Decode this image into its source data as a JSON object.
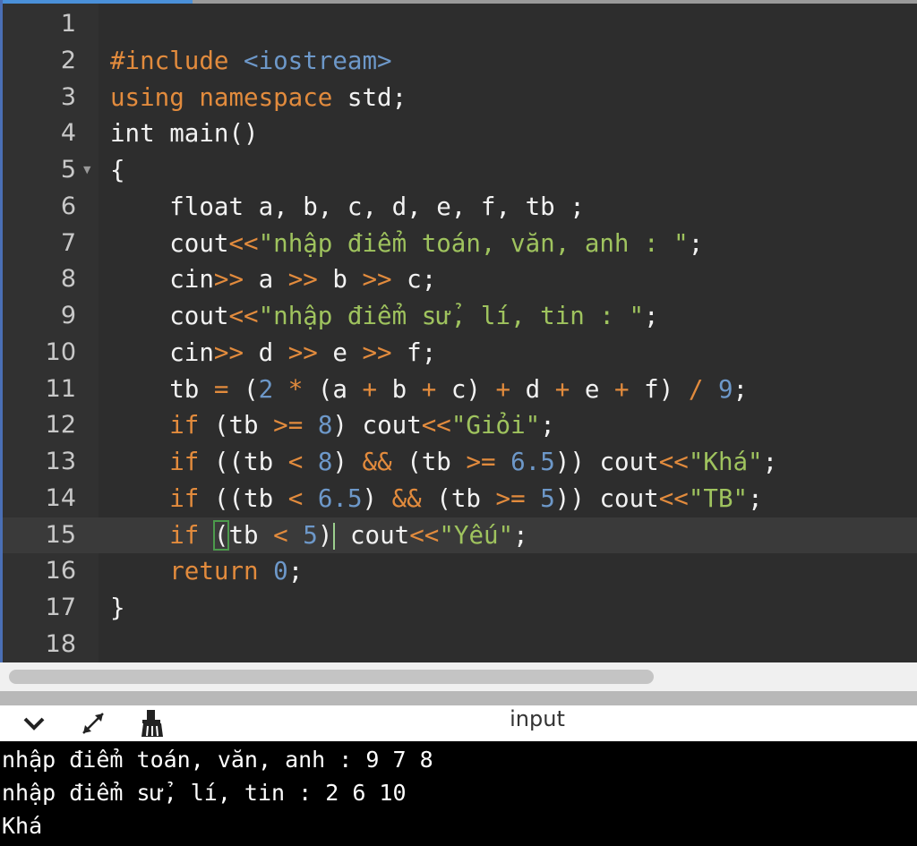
{
  "editor": {
    "active_line": 15,
    "lines": [
      {
        "num": "1",
        "tokens": []
      },
      {
        "num": "2",
        "tokens": [
          {
            "t": "#include ",
            "c": "kw"
          },
          {
            "t": "<iostream>",
            "c": "num"
          }
        ]
      },
      {
        "num": "3",
        "tokens": [
          {
            "t": "using namespace ",
            "c": "kw"
          },
          {
            "t": "std;",
            "c": ""
          }
        ]
      },
      {
        "num": "4",
        "tokens": [
          {
            "t": "int main()",
            "c": ""
          }
        ]
      },
      {
        "num": "5",
        "fold": true,
        "tokens": [
          {
            "t": "{",
            "c": ""
          }
        ]
      },
      {
        "num": "6",
        "tokens": [
          {
            "t": "    float a, b, c, d, e, f, tb ;",
            "c": ""
          }
        ]
      },
      {
        "num": "7",
        "tokens": [
          {
            "t": "    cout",
            "c": ""
          },
          {
            "t": "<<",
            "c": "op"
          },
          {
            "t": "\"nhập điểm toán, văn, anh : \"",
            "c": "str"
          },
          {
            "t": ";",
            "c": ""
          }
        ]
      },
      {
        "num": "8",
        "tokens": [
          {
            "t": "    cin",
            "c": ""
          },
          {
            "t": ">>",
            "c": "op"
          },
          {
            "t": " a ",
            "c": ""
          },
          {
            "t": ">>",
            "c": "op"
          },
          {
            "t": " b ",
            "c": ""
          },
          {
            "t": ">>",
            "c": "op"
          },
          {
            "t": " c;",
            "c": ""
          }
        ]
      },
      {
        "num": "9",
        "tokens": [
          {
            "t": "    cout",
            "c": ""
          },
          {
            "t": "<<",
            "c": "op"
          },
          {
            "t": "\"nhập điểm sử, lí, tin : \"",
            "c": "str"
          },
          {
            "t": ";",
            "c": ""
          }
        ]
      },
      {
        "num": "10",
        "tokens": [
          {
            "t": "    cin",
            "c": ""
          },
          {
            "t": ">>",
            "c": "op"
          },
          {
            "t": " d ",
            "c": ""
          },
          {
            "t": ">>",
            "c": "op"
          },
          {
            "t": " e ",
            "c": ""
          },
          {
            "t": ">>",
            "c": "op"
          },
          {
            "t": " f;",
            "c": ""
          }
        ]
      },
      {
        "num": "11",
        "tokens": [
          {
            "t": "    tb ",
            "c": ""
          },
          {
            "t": "=",
            "c": "op"
          },
          {
            "t": " (",
            "c": ""
          },
          {
            "t": "2",
            "c": "num"
          },
          {
            "t": " ",
            "c": ""
          },
          {
            "t": "*",
            "c": "op"
          },
          {
            "t": " (a ",
            "c": ""
          },
          {
            "t": "+",
            "c": "op"
          },
          {
            "t": " b ",
            "c": ""
          },
          {
            "t": "+",
            "c": "op"
          },
          {
            "t": " c) ",
            "c": ""
          },
          {
            "t": "+",
            "c": "op"
          },
          {
            "t": " d ",
            "c": ""
          },
          {
            "t": "+",
            "c": "op"
          },
          {
            "t": " e ",
            "c": ""
          },
          {
            "t": "+",
            "c": "op"
          },
          {
            "t": " f) ",
            "c": ""
          },
          {
            "t": "/",
            "c": "op"
          },
          {
            "t": " ",
            "c": ""
          },
          {
            "t": "9",
            "c": "num"
          },
          {
            "t": ";",
            "c": ""
          }
        ]
      },
      {
        "num": "12",
        "tokens": [
          {
            "t": "    ",
            "c": ""
          },
          {
            "t": "if",
            "c": "kw"
          },
          {
            "t": " (tb ",
            "c": ""
          },
          {
            "t": ">=",
            "c": "op"
          },
          {
            "t": " ",
            "c": ""
          },
          {
            "t": "8",
            "c": "num"
          },
          {
            "t": ") cout",
            "c": ""
          },
          {
            "t": "<<",
            "c": "op"
          },
          {
            "t": "\"Giỏi\"",
            "c": "str"
          },
          {
            "t": ";",
            "c": ""
          }
        ]
      },
      {
        "num": "13",
        "tokens": [
          {
            "t": "    ",
            "c": ""
          },
          {
            "t": "if",
            "c": "kw"
          },
          {
            "t": " ((tb ",
            "c": ""
          },
          {
            "t": "<",
            "c": "op"
          },
          {
            "t": " ",
            "c": ""
          },
          {
            "t": "8",
            "c": "num"
          },
          {
            "t": ") ",
            "c": ""
          },
          {
            "t": "&&",
            "c": "op"
          },
          {
            "t": " (tb ",
            "c": ""
          },
          {
            "t": ">=",
            "c": "op"
          },
          {
            "t": " ",
            "c": ""
          },
          {
            "t": "6.5",
            "c": "num"
          },
          {
            "t": ")) cout",
            "c": ""
          },
          {
            "t": "<<",
            "c": "op"
          },
          {
            "t": "\"Khá\"",
            "c": "str"
          },
          {
            "t": ";",
            "c": ""
          }
        ]
      },
      {
        "num": "14",
        "tokens": [
          {
            "t": "    ",
            "c": ""
          },
          {
            "t": "if",
            "c": "kw"
          },
          {
            "t": " ((tb ",
            "c": ""
          },
          {
            "t": "<",
            "c": "op"
          },
          {
            "t": " ",
            "c": ""
          },
          {
            "t": "6.5",
            "c": "num"
          },
          {
            "t": ") ",
            "c": ""
          },
          {
            "t": "&&",
            "c": "op"
          },
          {
            "t": " (tb ",
            "c": ""
          },
          {
            "t": ">=",
            "c": "op"
          },
          {
            "t": " ",
            "c": ""
          },
          {
            "t": "5",
            "c": "num"
          },
          {
            "t": ")) cout",
            "c": ""
          },
          {
            "t": "<<",
            "c": "op"
          },
          {
            "t": "\"TB\"",
            "c": "str"
          },
          {
            "t": ";",
            "c": ""
          }
        ]
      },
      {
        "num": "15",
        "tokens": [
          {
            "t": "    ",
            "c": ""
          },
          {
            "t": "if",
            "c": "kw"
          },
          {
            "t": " ",
            "c": ""
          },
          {
            "t": "(",
            "c": "bracket"
          },
          {
            "t": "tb ",
            "c": ""
          },
          {
            "t": "<",
            "c": "op"
          },
          {
            "t": " ",
            "c": ""
          },
          {
            "t": "5",
            "c": "num"
          },
          {
            "t": ")",
            "c": ""
          },
          {
            "t": "",
            "c": "cursor"
          },
          {
            "t": " cout",
            "c": ""
          },
          {
            "t": "<<",
            "c": "op"
          },
          {
            "t": "\"Yếu\"",
            "c": "str"
          },
          {
            "t": ";",
            "c": ""
          }
        ]
      },
      {
        "num": "16",
        "tokens": [
          {
            "t": "    ",
            "c": ""
          },
          {
            "t": "return",
            "c": "kw"
          },
          {
            "t": " ",
            "c": ""
          },
          {
            "t": "0",
            "c": "num"
          },
          {
            "t": ";",
            "c": ""
          }
        ]
      },
      {
        "num": "17",
        "tokens": [
          {
            "t": "}",
            "c": ""
          }
        ]
      },
      {
        "num": "18",
        "tokens": []
      }
    ]
  },
  "panel": {
    "title": "input",
    "icons": [
      "chevron-down-icon",
      "expand-icon",
      "clear-console-icon"
    ]
  },
  "console": {
    "lines": [
      "nhập điểm toán, văn, anh : 9 7 8",
      "nhập điểm sử, lí, tin : 2 6 10",
      "Khá"
    ]
  },
  "colors": {
    "keyword": "#e28b3d",
    "string": "#9fc35e",
    "number": "#6d98c9",
    "text": "#f2f2f2",
    "background": "#2d2d2d",
    "console_bg": "#000000"
  }
}
